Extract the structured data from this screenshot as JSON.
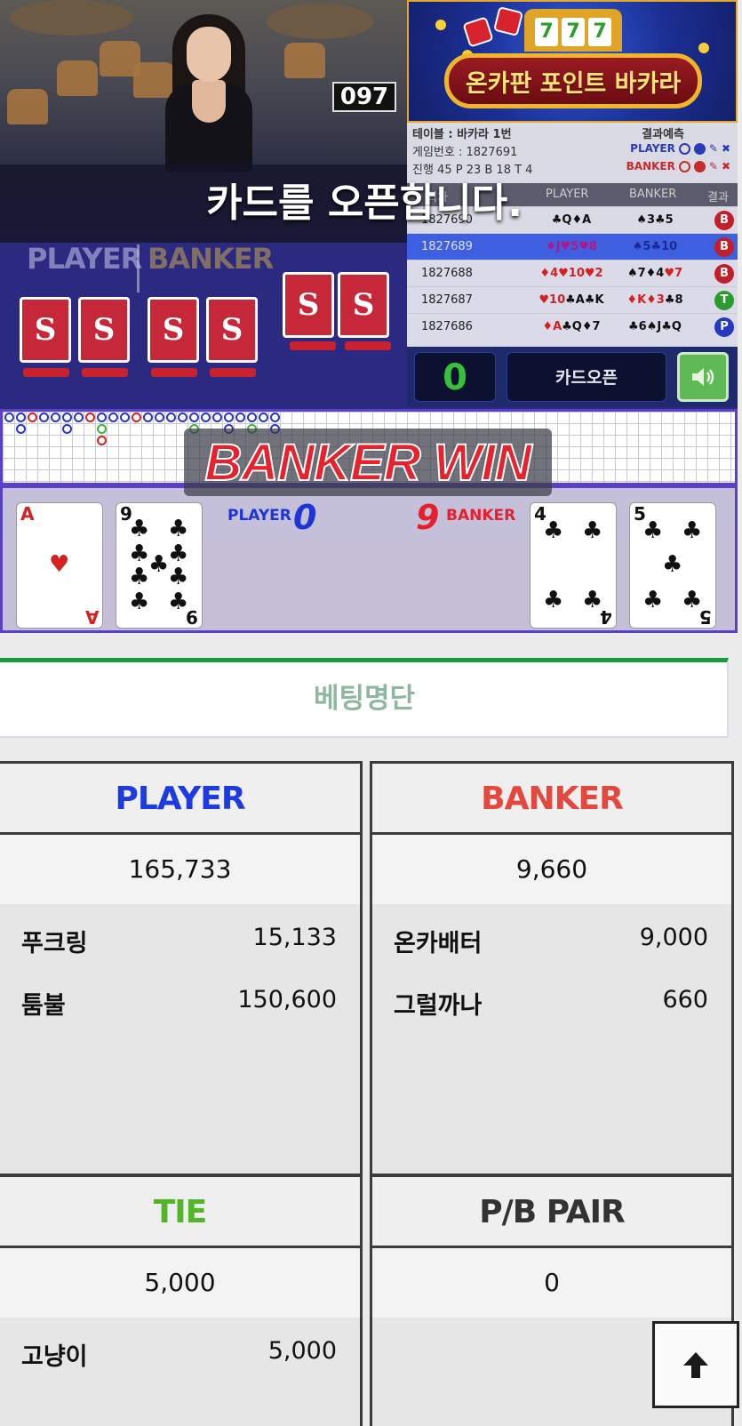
{
  "game": {
    "shoe_number": "097",
    "message": "카드를 오픈합니다.",
    "felt_player_label": "PLAYER",
    "felt_banker_label": "BANKER",
    "logo_text": "온카판 포인트 바카라",
    "slot_symbols": [
      "7",
      "7",
      "7"
    ],
    "info": {
      "table": "테이블 : 바카라 1번",
      "predict_label": "결과예측",
      "game_no": "게임번호 : 1827691",
      "progress": "진행 45   P 23   B 18   T 4",
      "player_pred": "PLAYER",
      "banker_pred": "BANKER"
    },
    "history_headers": [
      "회차",
      "PLAYER",
      "BANKER",
      "결과"
    ],
    "history": [
      {
        "round": "1827690",
        "player": "♣Q♦A",
        "banker": "♠3♣5",
        "result": "B",
        "result_color": "#c21f2a"
      },
      {
        "round": "1827689",
        "player": "♦J♥5♥8",
        "banker": "♠5♣10",
        "result": "B",
        "result_color": "#c21f2a"
      },
      {
        "round": "1827688",
        "player": "♦4♥10♥2",
        "banker": "♠7♦4♥7",
        "result": "B",
        "result_color": "#c21f2a"
      },
      {
        "round": "1827687",
        "player": "♥10♣A♣K",
        "banker": "♦K♦3♣8",
        "result": "T",
        "result_color": "#2a9c2e"
      },
      {
        "round": "1827686",
        "player": "♦A♣Q♦7",
        "banker": "♣6♠J♣Q",
        "result": "P",
        "result_color": "#2438c2"
      }
    ],
    "count": "0",
    "open_button": "카드오픈",
    "win_text": "BANKER WIN",
    "player_score_label": "PLAYER",
    "player_score": "0",
    "banker_score": "9",
    "banker_score_label": "BANKER",
    "player_cards": [
      {
        "rank": "A",
        "suit": "♥",
        "color": "#d42121"
      },
      {
        "rank": "9",
        "suit": "♣",
        "color": "#111111"
      }
    ],
    "banker_cards": [
      {
        "rank": "4",
        "suit": "♣",
        "color": "#111111"
      },
      {
        "rank": "5",
        "suit": "♣",
        "color": "#111111"
      }
    ]
  },
  "betting": {
    "title": "베팅명단",
    "player": {
      "head": "PLAYER",
      "color": "#1e3be0",
      "total": "165,733",
      "entries": [
        {
          "name": "푸크링",
          "amount": "15,133"
        },
        {
          "name": "툼불",
          "amount": "150,600"
        }
      ]
    },
    "banker": {
      "head": "BANKER",
      "color": "#e2483e",
      "total": "9,660",
      "entries": [
        {
          "name": "온카배터",
          "amount": "9,000"
        },
        {
          "name": "그럴까나",
          "amount": "660"
        }
      ]
    },
    "tie": {
      "head": "TIE",
      "color": "#52b52a",
      "total": "5,000",
      "entries": [
        {
          "name": "고냥이",
          "amount": "5,000"
        }
      ]
    },
    "pair": {
      "head": "P/B PAIR",
      "color": "#333333",
      "total": "0",
      "entries": []
    }
  }
}
